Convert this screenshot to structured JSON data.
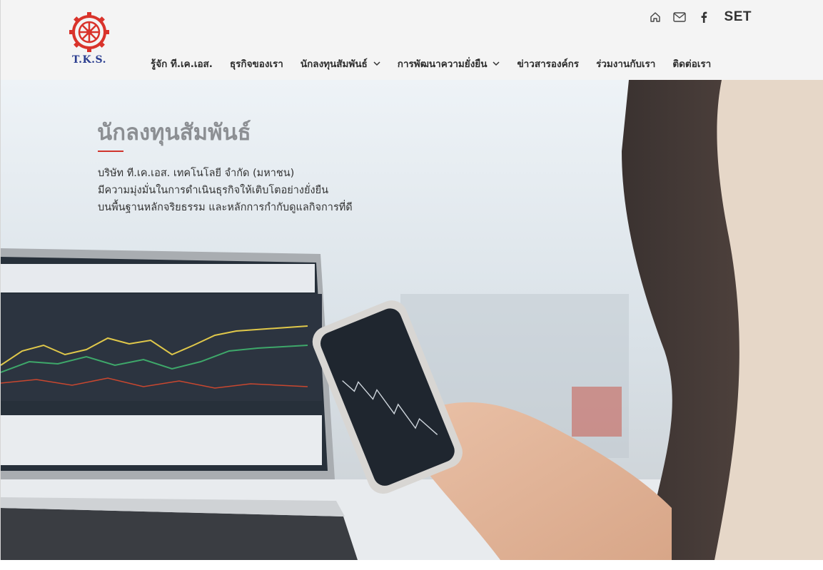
{
  "brand": {
    "logo_text": "T.K.S.",
    "logo_color": "#d9332b",
    "logo_text_color": "#2a3d8f"
  },
  "top_links": {
    "home_icon": "home-icon",
    "mail_icon": "mail-icon",
    "facebook_icon": "facebook-icon",
    "set_label": "SET"
  },
  "nav": {
    "items": [
      {
        "label": "รู้จัก ที.เค.เอส.",
        "has_dropdown": false
      },
      {
        "label": "ธุรกิจของเรา",
        "has_dropdown": false
      },
      {
        "label": "นักลงทุนสัมพันธ์",
        "has_dropdown": true
      },
      {
        "label": "การพัฒนาความยั่งยืน",
        "has_dropdown": true
      },
      {
        "label": "ข่าวสารองค์กร",
        "has_dropdown": false
      },
      {
        "label": "ร่วมงานกับเรา",
        "has_dropdown": false
      },
      {
        "label": "ติดต่อเรา",
        "has_dropdown": false
      }
    ]
  },
  "hero": {
    "title": "นักลงทุนสัมพันธ์",
    "accent_color": "#d0342c",
    "description": [
      "บริษัท ที.เค.เอส. เทคโนโลยี จำกัด (มหาชน)",
      "มีความมุ่งมั่นในการดำเนินธุรกิจให้เติบโตอย่างยั่งยืน",
      "บนพื้นฐานหลักจริยธรรม และหลักการกำกับดูแลกิจการที่ดี"
    ]
  }
}
